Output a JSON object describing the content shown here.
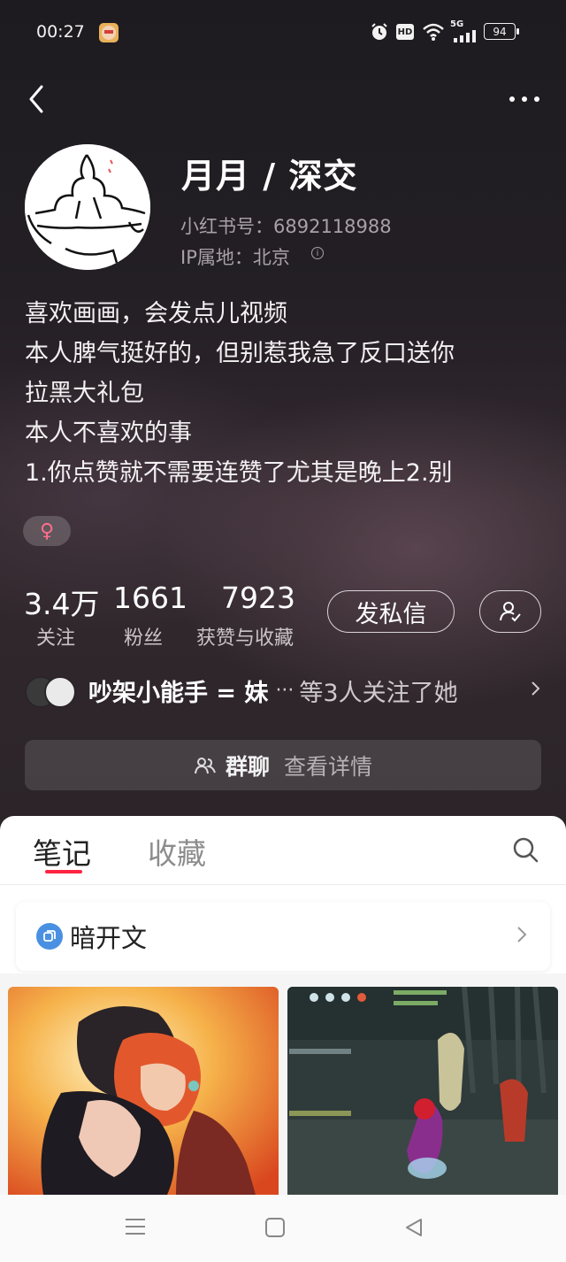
{
  "status_bar": {
    "time": "00:27",
    "hd": "HD",
    "network": "5G",
    "battery": "94"
  },
  "profile": {
    "name": "月月 / 深交",
    "xhs_id": "小红书号：6892118988",
    "ip_location": "IP属地：北京",
    "bio_lines": [
      "喜欢画画，会发点儿视频",
      "本人脾气挺好的，但别惹我急了反口送你",
      "拉黑大礼包",
      "本人不喜欢的事",
      "1.你点赞就不需要连赞了尤其是晚上2.别"
    ],
    "gender_symbol": "♀"
  },
  "stats": [
    {
      "value": "3.4万",
      "label": "关注"
    },
    {
      "value": "1661",
      "label": "粉丝"
    },
    {
      "value": "7923",
      "label": "获赞与收藏"
    }
  ],
  "actions": {
    "message_label": "发私信"
  },
  "followed_by": {
    "name": "吵架小能手 = 妹",
    "ellipsis": "···",
    "suffix": "等3人关注了她"
  },
  "group_chat": {
    "label": "群聊",
    "detail": "查看详情"
  },
  "tabs": [
    {
      "label": "笔记",
      "active": true
    },
    {
      "label": "收藏",
      "active": false
    }
  ],
  "collection": {
    "title": "暗开文"
  },
  "colors": {
    "accent": "#ff2442",
    "collection_icon": "#4a90e2",
    "gender": "#ff6f8d"
  }
}
